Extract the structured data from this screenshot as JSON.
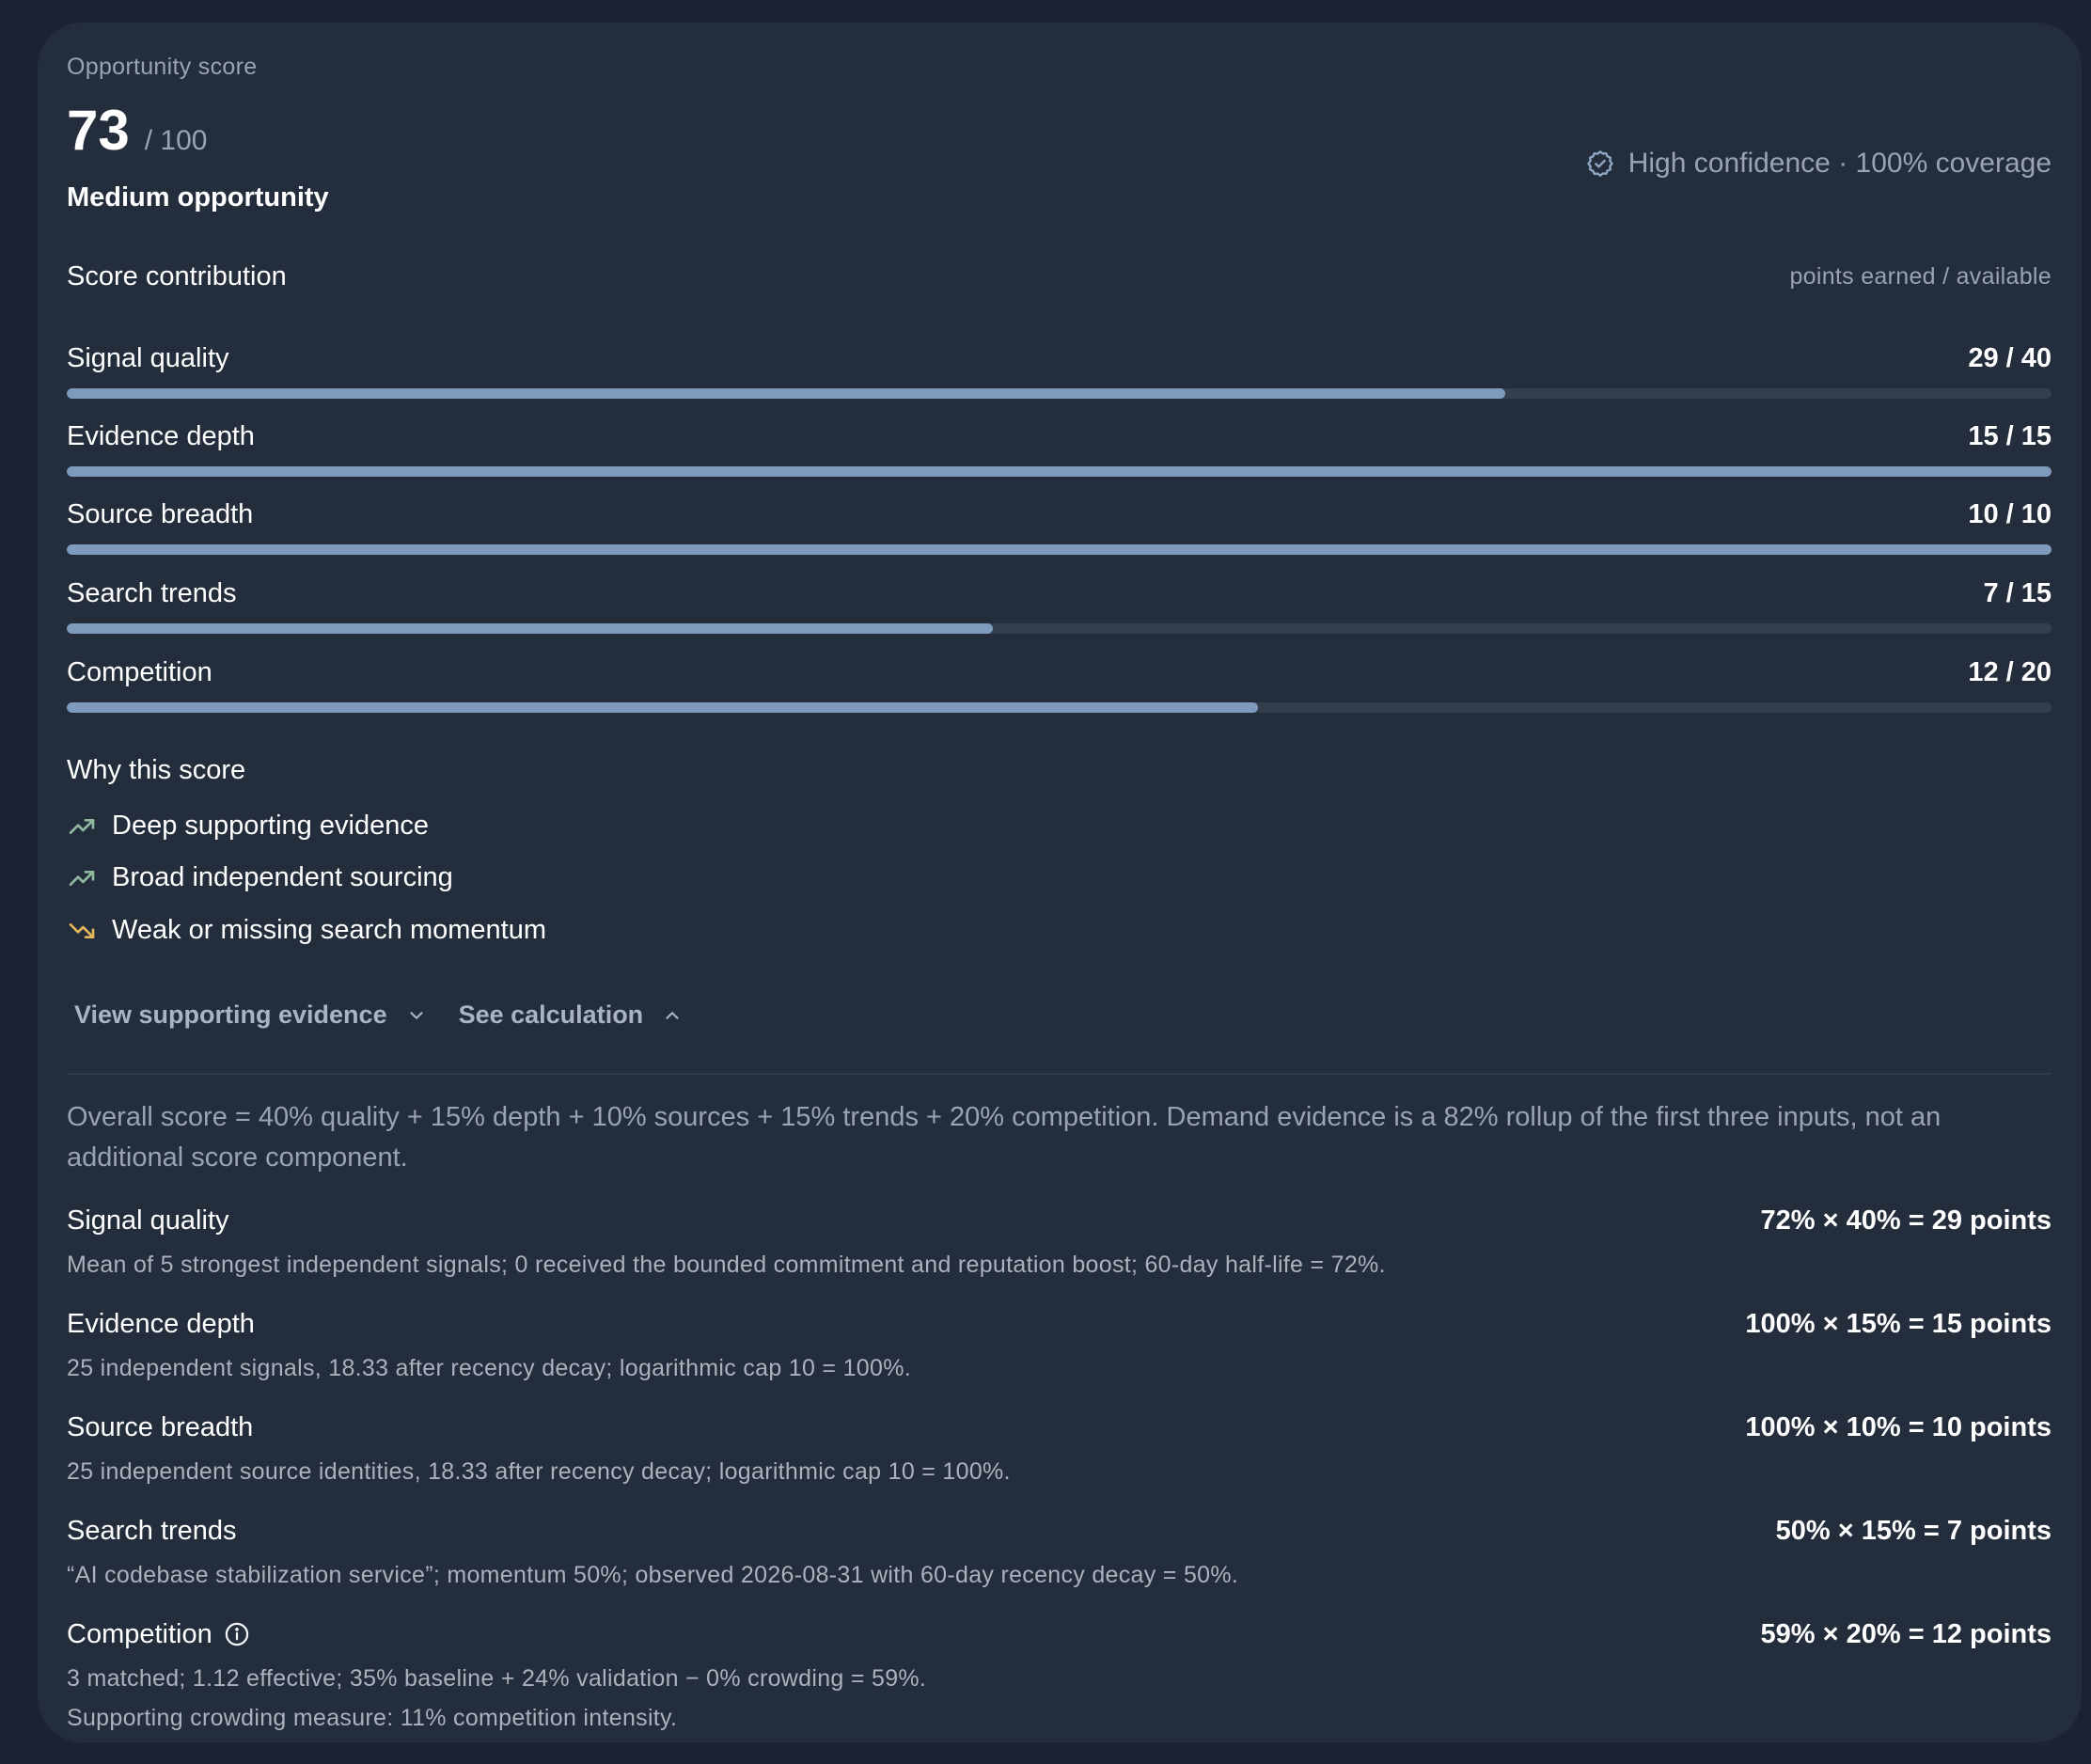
{
  "header": {
    "eyebrow": "Opportunity score",
    "score": "73",
    "score_max": "/ 100",
    "tier": "Medium opportunity",
    "confidence_icon": "badge-check-icon",
    "confidence": "High confidence · 100% coverage"
  },
  "contribution": {
    "title": "Score contribution",
    "legend": "points earned / available",
    "rows": [
      {
        "label": "Signal quality",
        "value": "29 / 40",
        "earned": 29,
        "available": 40
      },
      {
        "label": "Evidence depth",
        "value": "15 / 15",
        "earned": 15,
        "available": 15
      },
      {
        "label": "Source breadth",
        "value": "10 / 10",
        "earned": 10,
        "available": 10
      },
      {
        "label": "Search trends",
        "value": "7 / 15",
        "earned": 7,
        "available": 15
      },
      {
        "label": "Competition",
        "value": "12 / 20",
        "earned": 12,
        "available": 20
      }
    ],
    "bar_color": "#7e9bbd",
    "track_color": "#353e4c"
  },
  "why": {
    "title": "Why this score",
    "items": [
      {
        "icon": "trend-up-icon",
        "color": "#8fb8a0",
        "text": "Deep supporting evidence"
      },
      {
        "icon": "trend-up-icon",
        "color": "#8fb8a0",
        "text": "Broad independent sourcing"
      },
      {
        "icon": "trend-down-icon",
        "color": "#e2b65a",
        "text": "Weak or missing search momentum"
      }
    ]
  },
  "actions": {
    "view_evidence": "View supporting evidence",
    "see_calculation": "See calculation"
  },
  "calculation": {
    "formula": "Overall score = 40% quality + 15% depth + 10% sources + 15% trends + 20% competition. Demand evidence is a 82% rollup of the first three inputs, not an additional score component.",
    "rows": [
      {
        "label": "Signal quality",
        "value": "72% × 40% = 29 points",
        "notes": [
          "Mean of 5 strongest independent signals; 0 received the bounded commitment and reputation boost; 60-day half-life = 72%."
        ]
      },
      {
        "label": "Evidence depth",
        "value": "100% × 15% = 15 points",
        "notes": [
          "25 independent signals, 18.33 after recency decay; logarithmic cap 10 = 100%."
        ]
      },
      {
        "label": "Source breadth",
        "value": "100% × 10% = 10 points",
        "notes": [
          "25 independent source identities, 18.33 after recency decay; logarithmic cap 10 = 100%."
        ]
      },
      {
        "label": "Search trends",
        "value": "50% × 15% = 7 points",
        "notes": [
          "“AI codebase stabilization service”; momentum 50%; observed 2026-08-31 with 60-day recency decay = 50%."
        ]
      },
      {
        "label": "Competition",
        "value": "59% × 20% = 12 points",
        "info_icon": "info-icon",
        "notes": [
          "3 matched; 1.12 effective; 35% baseline + 24% validation − 0% crowding = 59%.",
          "Supporting crowding measure: 11% competition intensity."
        ]
      }
    ]
  }
}
